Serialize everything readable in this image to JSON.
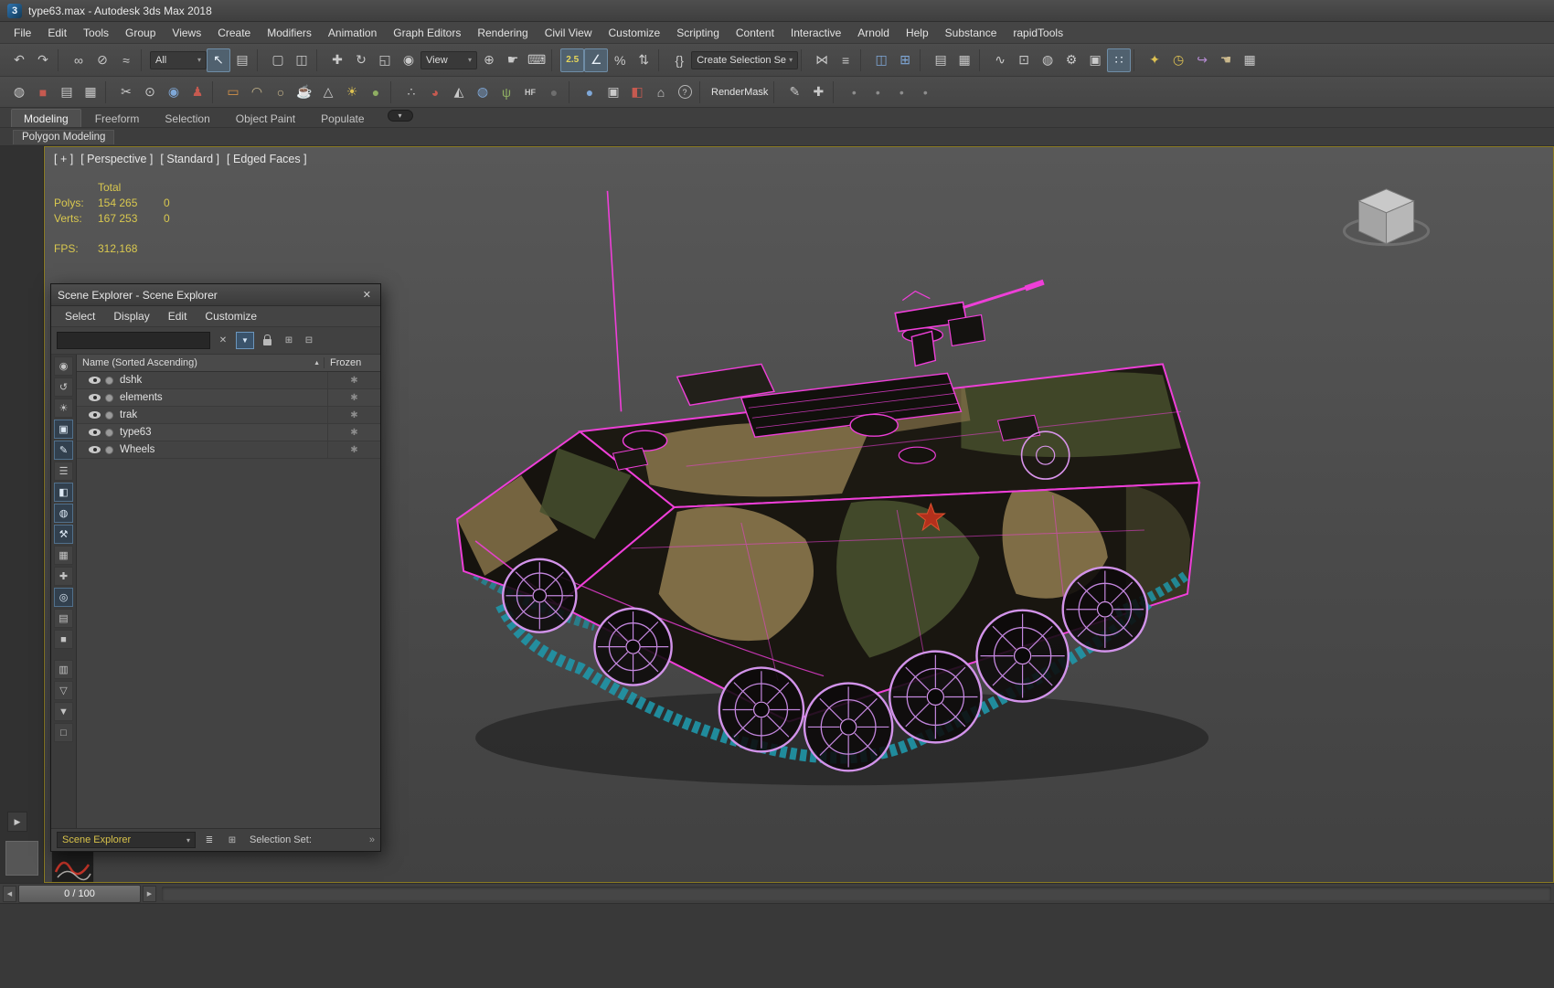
{
  "window": {
    "title": "type63.max - Autodesk 3ds Max 2018",
    "logo": "3"
  },
  "colors": {
    "wireframe": "#ee3fd8",
    "wheels": "#d293ea",
    "tracks": "#1f96a8",
    "stats_text": "#d9c84f",
    "selected_label": "#d8c24a"
  },
  "menubar": {
    "items": [
      {
        "label": "File",
        "n": "menu-file"
      },
      {
        "label": "Edit",
        "n": "menu-edit"
      },
      {
        "label": "Tools",
        "n": "menu-tools"
      },
      {
        "label": "Group",
        "n": "menu-group"
      },
      {
        "label": "Views",
        "n": "menu-views"
      },
      {
        "label": "Create",
        "n": "menu-create"
      },
      {
        "label": "Modifiers",
        "n": "menu-modifiers"
      },
      {
        "label": "Animation",
        "n": "menu-animation"
      },
      {
        "label": "Graph Editors",
        "n": "menu-graph-editors"
      },
      {
        "label": "Rendering",
        "n": "menu-rendering"
      },
      {
        "label": "Civil View",
        "n": "menu-civil-view"
      },
      {
        "label": "Customize",
        "n": "menu-customize"
      },
      {
        "label": "Scripting",
        "n": "menu-scripting"
      },
      {
        "label": "Content",
        "n": "menu-content"
      },
      {
        "label": "Interactive",
        "n": "menu-interactive"
      },
      {
        "label": "Arnold",
        "n": "menu-arnold"
      },
      {
        "label": "Help",
        "n": "menu-help"
      },
      {
        "label": "Substance",
        "n": "menu-substance"
      },
      {
        "label": "rapidTools",
        "n": "menu-rapidtools"
      }
    ]
  },
  "toolbar_main": {
    "items": [
      {
        "n": "undo-icon",
        "g": "↶"
      },
      {
        "n": "redo-icon",
        "g": "↷"
      },
      {
        "cls": "sep"
      },
      {
        "n": "select-and-link-icon",
        "g": "∞"
      },
      {
        "n": "unlink-selection-icon",
        "g": "⊘"
      },
      {
        "n": "bind-to-spacewarp-icon",
        "g": "≈"
      },
      {
        "cls": "sep"
      },
      {
        "n": "selection-filter-dropdown",
        "label": "All",
        "arrow": "▾",
        "cls": "dd"
      },
      {
        "n": "select-object-icon",
        "g": "↖",
        "cls": "pressed"
      },
      {
        "n": "select-by-name-icon",
        "g": "▤"
      },
      {
        "cls": "sep"
      },
      {
        "n": "rectangular-selection-icon",
        "g": "▢"
      },
      {
        "n": "window-crossing-icon",
        "g": "◫"
      },
      {
        "cls": "sep"
      },
      {
        "n": "select-and-move-icon",
        "g": "✚"
      },
      {
        "n": "select-and-rotate-icon",
        "g": "↻"
      },
      {
        "n": "select-and-scale-icon",
        "g": "◱"
      },
      {
        "n": "select-and-place-icon",
        "g": "◉"
      },
      {
        "n": "reference-coordinate-dropdown",
        "label": "View",
        "arrow": "▾",
        "cls": "dd"
      },
      {
        "n": "use-pivot-center-icon",
        "g": "⊕"
      },
      {
        "n": "select-and-manipulate-icon",
        "g": "☛"
      },
      {
        "n": "keyboard-override-icon",
        "g": "⌨"
      },
      {
        "cls": "sep"
      },
      {
        "n": "snap-toggle-icon",
        "label": "2.5",
        "cls": "pressed snaplbl"
      },
      {
        "n": "angle-snap-icon",
        "g": "∠",
        "cls": "pressed"
      },
      {
        "n": "percent-snap-icon",
        "g": "%"
      },
      {
        "n": "spinner-snap-icon",
        "g": "⇅"
      },
      {
        "cls": "sep"
      },
      {
        "n": "edit-named-selections-icon",
        "g": "{}"
      },
      {
        "n": "named-selection-dropdown",
        "label": "Create Selection Se",
        "arrow": "▾",
        "cls": "dd wide"
      },
      {
        "cls": "sep"
      },
      {
        "n": "mirror-icon",
        "g": "⋈"
      },
      {
        "n": "align-icon",
        "g": "≡"
      },
      {
        "cls": "sep"
      },
      {
        "n": "toggle-scene-explorer-icon",
        "g": "◫",
        "cls": "cblue"
      },
      {
        "n": "toggle-layer-explorer-icon",
        "g": "⊞",
        "cls": "cblue"
      },
      {
        "cls": "sep"
      },
      {
        "n": "layer-manager-icon",
        "g": "▤"
      },
      {
        "n": "toggle-ribbon-icon",
        "g": "▦"
      },
      {
        "cls": "sep"
      },
      {
        "n": "curve-editor-icon",
        "g": "∿"
      },
      {
        "n": "schematic-view-icon",
        "g": "⊡"
      },
      {
        "n": "material-editor-icon",
        "g": "◍"
      },
      {
        "n": "render-setup-icon",
        "g": "⚙"
      },
      {
        "n": "rendered-frame-icon",
        "g": "▣"
      },
      {
        "n": "grid-dots-icon",
        "g": "∷",
        "cls": "pressed"
      },
      {
        "cls": "sep"
      },
      {
        "n": "rapidtools-star-icon",
        "g": "✦",
        "cls": "cyellow"
      },
      {
        "n": "rapidtools-clock-icon",
        "g": "◷",
        "cls": "cyellow"
      },
      {
        "n": "rapidtools-arrow-icon",
        "g": "↪",
        "cls": "cpurple"
      },
      {
        "n": "rapidtools-hand-icon",
        "g": "☚",
        "cls": "ctan"
      },
      {
        "n": "viewport-layout-icon",
        "g": "▦"
      }
    ]
  },
  "toolbar_secondary": {
    "items": [
      {
        "n": "material-map-icon",
        "g": "◍"
      },
      {
        "n": "red-swatch-icon",
        "g": "■",
        "cls": "cred"
      },
      {
        "n": "sheet-icon",
        "g": "▤"
      },
      {
        "n": "grid-sheet-icon",
        "g": "▦"
      },
      {
        "cls": "sep"
      },
      {
        "n": "scissors-icon",
        "g": "✂"
      },
      {
        "n": "target-icon",
        "g": "⊙"
      },
      {
        "n": "projector-icon",
        "g": "◉",
        "cls": "cblue"
      },
      {
        "n": "character-icon",
        "g": "♟",
        "cls": "cred"
      },
      {
        "cls": "sep"
      },
      {
        "n": "plane-primitive-icon",
        "g": "▭",
        "cls": "corange"
      },
      {
        "n": "dome-primitive-icon",
        "g": "◠",
        "cls": "ctan"
      },
      {
        "n": "circle-primitive-icon",
        "g": "○",
        "cls": "ctan"
      },
      {
        "n": "teapot-primitive-icon",
        "g": "☕",
        "cls": "ctan"
      },
      {
        "n": "cone-primitive-icon",
        "g": "△"
      },
      {
        "n": "sun-icon",
        "g": "☀",
        "cls": "cyellow"
      },
      {
        "n": "sphere-primitive-icon",
        "g": "●",
        "cls": "cgreen"
      },
      {
        "cls": "sep"
      },
      {
        "n": "particle-array-icon",
        "g": "∴"
      },
      {
        "n": "quarter-sphere-icon",
        "g": "◕",
        "cls": "cred"
      },
      {
        "n": "pyramid-icon",
        "g": "◭"
      },
      {
        "n": "globe-icon",
        "g": "◍",
        "cls": "cblue"
      },
      {
        "n": "foliage-icon",
        "g": "ψ",
        "cls": "cgreen"
      },
      {
        "n": "hf-tool-icon",
        "g": "HF",
        "cls": "txt"
      },
      {
        "n": "dark-sphere-icon",
        "g": "●",
        "cls": "cdark"
      },
      {
        "cls": "sep"
      },
      {
        "n": "blue-sphere-icon",
        "g": "●",
        "cls": "cblue"
      },
      {
        "n": "layered-square-icon",
        "g": "▣"
      },
      {
        "n": "half-red-icon",
        "g": "◧",
        "cls": "cred"
      },
      {
        "n": "building-icon",
        "g": "⌂"
      },
      {
        "n": "help-icon",
        "g": "?",
        "cls": "circ"
      },
      {
        "cls": "sep"
      },
      {
        "n": "rendermask-button",
        "label": "RenderMask",
        "cls": "label"
      },
      {
        "cls": "sep"
      },
      {
        "n": "knife-icon",
        "g": "✎"
      },
      {
        "n": "add-plus-icon",
        "g": "✚"
      },
      {
        "cls": "sep"
      },
      {
        "n": "indicator-dot-1",
        "g": "•",
        "cls": "dim"
      },
      {
        "n": "indicator-dot-2",
        "g": "•",
        "cls": "dim"
      },
      {
        "n": "indicator-dot-3",
        "g": "•",
        "cls": "dim"
      },
      {
        "n": "indicator-dot-4",
        "g": "•",
        "cls": "dim"
      }
    ]
  },
  "ribbon": {
    "tabs": [
      {
        "label": "Modeling",
        "n": "tab-modeling",
        "cls": "active"
      },
      {
        "label": "Freeform",
        "n": "tab-freeform"
      },
      {
        "label": "Selection",
        "n": "tab-selection"
      },
      {
        "label": "Object Paint",
        "n": "tab-object-paint"
      },
      {
        "label": "Populate",
        "n": "tab-populate"
      },
      {
        "label": "▾",
        "n": "ribbon-config-dropdown",
        "cls": "cfg"
      }
    ],
    "panel_label": "Polygon Modeling"
  },
  "viewport": {
    "label_segments": [
      {
        "t": "[ + ]",
        "n": "viewport-general-menu"
      },
      {
        "t": "[ Perspective ]",
        "n": "viewport-pov-menu"
      },
      {
        "t": "[ Standard ]",
        "n": "viewport-shading-preset-menu"
      },
      {
        "t": "[ Edged Faces ]",
        "n": "viewport-display-mode-menu"
      }
    ],
    "stats": {
      "total": "Total",
      "polys_label": "Polys:",
      "polys": "154 265",
      "polys2": "0",
      "verts_label": "Verts:",
      "verts": "167 253",
      "verts2": "0",
      "fps_label": "FPS:",
      "fps": "312,168"
    }
  },
  "left_dock": {
    "expand_glyph": "▶"
  },
  "scene_explorer": {
    "title": "Scene Explorer - Scene Explorer",
    "close_glyph": "✕",
    "menus": [
      {
        "label": "Select",
        "n": "se-menu-select"
      },
      {
        "label": "Display",
        "n": "se-menu-display"
      },
      {
        "label": "Edit",
        "n": "se-menu-edit"
      },
      {
        "label": "Customize",
        "n": "se-menu-customize"
      }
    ],
    "search_clear_glyph": "✕",
    "filter_glyph": "▼",
    "tree_icons": [
      {
        "n": "se-expand-all-icon",
        "g": "⊞"
      },
      {
        "n": "se-collapse-all-icon",
        "g": "⊟"
      }
    ],
    "header": {
      "name": "Name (Sorted Ascending)",
      "sort_glyph": "▲",
      "frozen": "Frozen"
    },
    "rows": [
      {
        "name": "dshk",
        "frozen_glyph": "✱"
      },
      {
        "name": "elements",
        "frozen_glyph": "✱"
      },
      {
        "name": "trak",
        "frozen_glyph": "✱"
      },
      {
        "name": "type63",
        "frozen_glyph": "✱"
      },
      {
        "name": "Wheels",
        "frozen_glyph": "✱"
      }
    ],
    "side_icons": [
      {
        "n": "se-display-sort-icon",
        "g": "◉"
      },
      {
        "n": "se-sync-selection-icon",
        "g": "↺"
      },
      {
        "n": "se-display-lights-icon",
        "g": "☀"
      },
      {
        "n": "se-display-cameras-icon",
        "g": "▣",
        "cls": "pressed"
      },
      {
        "n": "se-display-helpers-icon",
        "g": "✎",
        "cls": "pressed"
      },
      {
        "n": "se-display-layers-icon",
        "g": "☰"
      },
      {
        "n": "se-display-groups-icon",
        "g": "◧",
        "cls": "pressed"
      },
      {
        "n": "se-display-xrefs-icon",
        "g": "◍",
        "cls": "pressed"
      },
      {
        "n": "se-display-tools-icon",
        "g": "⚒",
        "cls": "pressed"
      },
      {
        "n": "se-display-grid-icon",
        "g": "▦"
      },
      {
        "n": "se-display-shapes-icon",
        "g": "✚"
      },
      {
        "n": "se-display-visibility-icon",
        "g": "◎",
        "cls": "pressed"
      },
      {
        "n": "se-display-notes-icon",
        "g": "▤"
      },
      {
        "n": "se-display-frozen-icon",
        "g": "■"
      },
      {
        "n": "se-display-list-icon",
        "g": "▥",
        "cls": "gap"
      },
      {
        "n": "se-filter-combinations-icon",
        "g": "▽"
      },
      {
        "n": "se-advanced-filter-icon",
        "g": "▼"
      },
      {
        "n": "se-container-icon",
        "g": "□"
      }
    ],
    "footer": {
      "dropdown_value": "Scene Explorer",
      "dropdown_arrow": "▾",
      "layers_glyph": "≣",
      "new_explorer_glyph": "⊞",
      "selection_set_label": "Selection Set:",
      "more_glyph": "»"
    }
  },
  "timeline": {
    "frame_label": "0 / 100",
    "prev_glyph": "◀",
    "next_glyph": "▶"
  }
}
